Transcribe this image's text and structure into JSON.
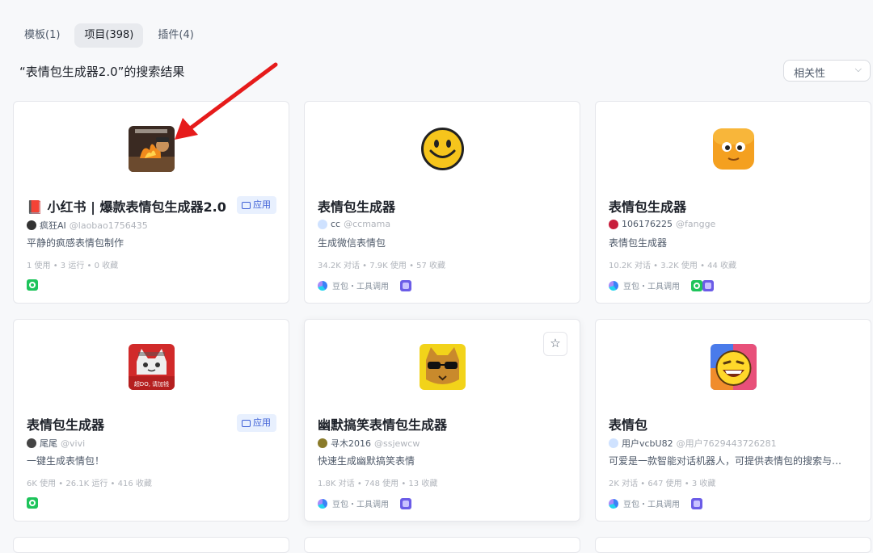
{
  "tabs": [
    {
      "label": "模板(1)"
    },
    {
      "label": "项目(398)"
    },
    {
      "label": "插件(4)"
    }
  ],
  "result_title": "“表情包生成器2.0”的搜索结果",
  "sort": {
    "label": "相关性",
    "chevron": "⌵"
  },
  "colors": {
    "accent_arrow": "#e61b1b",
    "badge_bg": "#e8f0fe",
    "badge_text": "#3d5fd6"
  },
  "cards": [
    {
      "name": "📕 小红书 | 爆款表情包生成器2.0",
      "badge": "应用",
      "author": "疯狂AI",
      "handle": "@laobao1756435",
      "desc": "平静的疯感表情包制作",
      "stats": "1 使用 • 3 运行 • 0 收藏",
      "avatar_icon": "cartoon-avatar-icon",
      "foot_icons": [
        "workflow-icon"
      ]
    },
    {
      "name": "表情包生成器",
      "author": "cc",
      "handle": "@ccmama",
      "desc": "生成微信表情包",
      "stats": "34.2K 对话 • 7.9K 使用 • 57 收藏",
      "platform": "豆包・工具调用",
      "avatar_icon": "smiley-face-icon",
      "foot_icons": [
        "plugin-icon"
      ]
    },
    {
      "name": "表情包生成器",
      "author": "106176225",
      "handle": "@fangge",
      "desc": "表情包生成器",
      "stats": "10.2K 对话 • 3.2K 使用 • 44 收藏",
      "platform": "豆包・工具调用",
      "avatar_icon": "orange-cube-face-icon",
      "foot_icons": [
        "workflow-icon",
        "plugin-icon"
      ]
    },
    {
      "name": "表情包生成器",
      "badge": "应用",
      "author": "尾尾",
      "handle": "@vivi",
      "desc": "一键生成表情包！",
      "stats": "6K 使用 • 26.1K 运行 • 416 收藏",
      "avatar_icon": "cat-avatar-icon",
      "avatar_text": "超DO, 请加钱",
      "foot_icons": [
        "workflow-icon"
      ]
    },
    {
      "name": "幽默搞笑表情包生成器",
      "author": "寻木2016",
      "handle": "@ssjewcw",
      "desc": "快速生成幽默搞笑表情",
      "stats": "1.8K 对话 • 748 使用 • 13 收藏",
      "platform": "豆包・工具调用",
      "avatar_icon": "cool-cat-sunglasses-icon",
      "star": "☆",
      "foot_icons": [
        "plugin-icon"
      ]
    },
    {
      "name": "表情包",
      "author": "用户vcbU82",
      "handle": "@用户7629443726281",
      "desc": "可爱是一款智能对话机器人，可提供表情包的搜索与…",
      "stats": "2K 对话 • 647 使用 • 3 收藏",
      "platform": "豆包・工具调用",
      "avatar_icon": "laughing-emoji-icon",
      "foot_icons": [
        "plugin-icon"
      ]
    }
  ]
}
